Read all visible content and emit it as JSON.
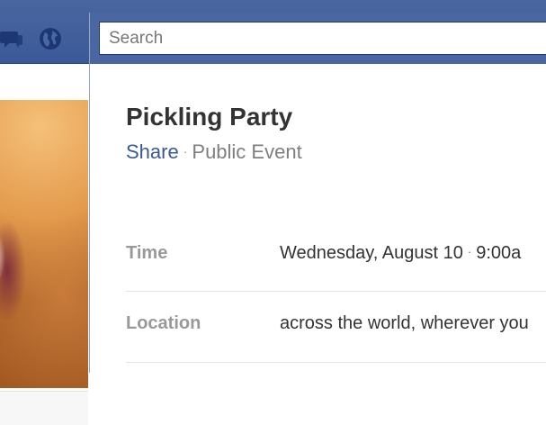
{
  "search": {
    "placeholder": "Search"
  },
  "event": {
    "title": "Pickling Party",
    "share_label": "Share",
    "privacy": "Public Event",
    "time_label": "Time",
    "time_date": "Wednesday, August 10",
    "time_start": "9:00a",
    "location_label": "Location",
    "location_value": "across the world, wherever you"
  },
  "colors": {
    "header_blue": "#3b5998",
    "link_blue": "#3b5998",
    "label_gray": "#999999"
  },
  "icons": {
    "messages": "messages-icon",
    "notifications": "globe-icon"
  }
}
